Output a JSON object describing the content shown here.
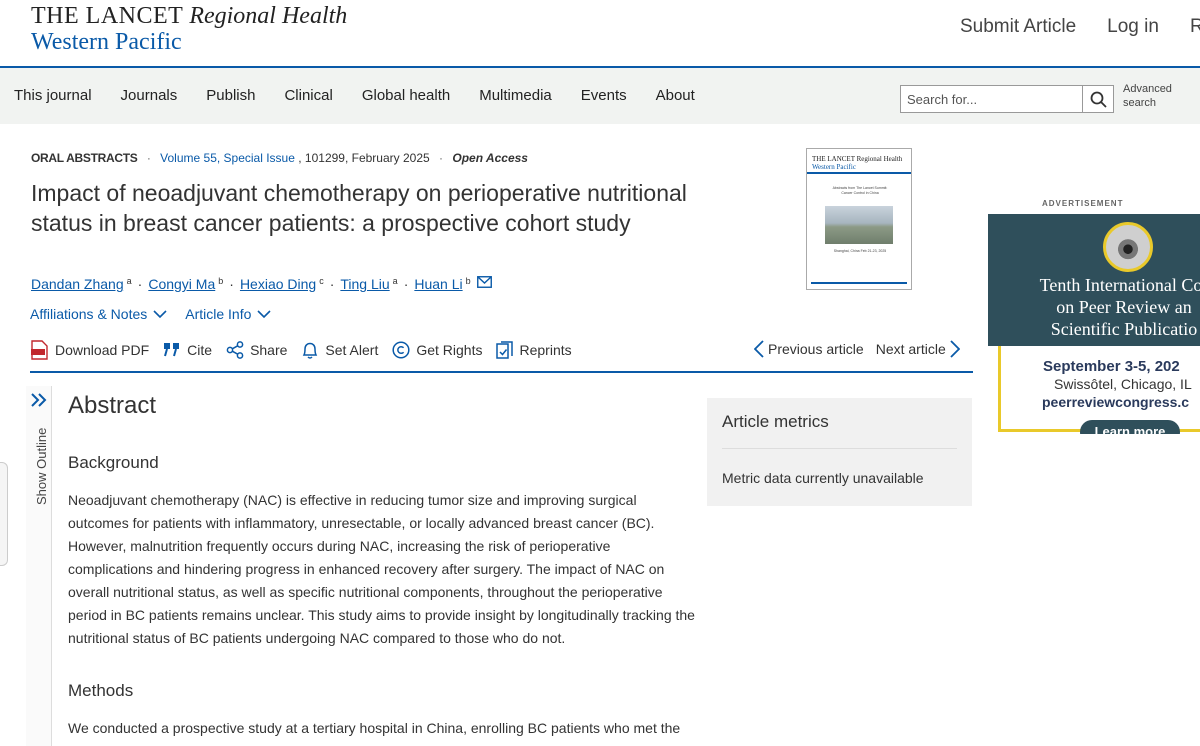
{
  "header": {
    "logo_brand": "THE LANCET",
    "logo_journal": "Regional Health",
    "logo_region": "Western Pacific",
    "links": [
      "Submit Article",
      "Log in",
      "Re"
    ]
  },
  "nav": {
    "items": [
      "This journal",
      "Journals",
      "Publish",
      "Clinical",
      "Global health",
      "Multimedia",
      "Events",
      "About"
    ],
    "search_placeholder": "Search for...",
    "advanced_search": "Advanced search"
  },
  "article": {
    "section": "ORAL ABSTRACTS",
    "volume": "Volume 55, Special Issue",
    "citation": ", 101299, February 2025",
    "access": "Open Access",
    "title": "Impact of neoadjuvant chemotherapy on perioperative nutritional status in breast cancer patients: a prospective cohort study",
    "authors": [
      {
        "name": "Dandan Zhang",
        "sup": "a"
      },
      {
        "name": "Congyi Ma",
        "sup": "b"
      },
      {
        "name": "Hexiao Ding",
        "sup": "c"
      },
      {
        "name": "Ting Liu",
        "sup": "a"
      },
      {
        "name": "Huan Li",
        "sup": "b"
      }
    ],
    "affiliations_toggle": "Affiliations & Notes",
    "article_info_toggle": "Article Info"
  },
  "actions": {
    "download_pdf": "Download PDF",
    "cite": "Cite",
    "share": "Share",
    "set_alert": "Set Alert",
    "get_rights": "Get Rights",
    "reprints": "Reprints",
    "previous": "Previous article",
    "next": "Next article"
  },
  "cover": {
    "brand": "THE LANCET Regional Health",
    "region": "Western Pacific",
    "text": "Abstracts from The Lancet Summit: Cancer Control in China",
    "subtext": "Shanghai, China Feb 21-23, 2025"
  },
  "ad": {
    "label": "ADVERTISEMENT",
    "title_lines": [
      "Tenth International Cor",
      "on Peer Review an",
      "Scientific Publicatio"
    ],
    "date": "September 3-5, 202",
    "venue": "Swissôtel, Chicago, IL",
    "url": "peerreviewcongress.c",
    "button": "Learn more"
  },
  "outline": {
    "label": "Show Outline"
  },
  "abstract": {
    "heading": "Abstract",
    "background_heading": "Background",
    "background_text": "Neoadjuvant chemotherapy (NAC) is effective in reducing tumor size and improving surgical outcomes for patients with inflammatory, unresectable, or locally advanced breast cancer (BC). However, malnutrition frequently occurs during NAC, increasing the risk of perioperative complications and hindering progress in enhanced recovery after surgery. The impact of NAC on overall nutritional status, as well as specific nutritional components, throughout the perioperative period in BC patients remains unclear. This study aims to provide insight by longitudinally tracking the nutritional status of BC patients undergoing NAC compared to those who do not.",
    "methods_heading": "Methods",
    "methods_text": "We conducted a prospective study at a tertiary hospital in China, enrolling BC patients who met the"
  },
  "metrics": {
    "heading": "Article metrics",
    "message": "Metric data currently unavailable"
  },
  "colors": {
    "brand_blue": "#0a5aa8",
    "ad_teal": "#2f4f5b",
    "ad_yellow": "#e9c92a"
  }
}
